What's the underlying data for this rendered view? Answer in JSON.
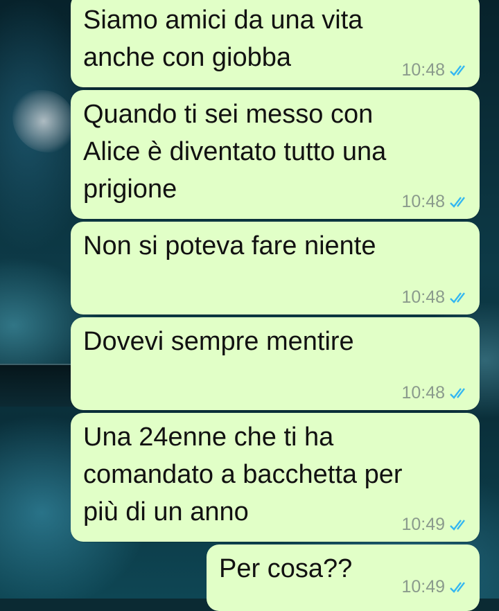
{
  "colors": {
    "bubble": "#e1ffc7",
    "text": "#111111",
    "time": "#8a9a8c",
    "read_ticks": "#34b7f1"
  },
  "messages": [
    {
      "text": "Siamo amici da una vita\nanche con giobba",
      "time": "10:48",
      "status_icon": "double-check-read-icon"
    },
    {
      "text": "Quando ti sei messo con\nAlice è diventato tutto una\nprigione",
      "time": "10:48",
      "status_icon": "double-check-read-icon"
    },
    {
      "text": "Non si poteva fare niente",
      "time": "10:48",
      "status_icon": "double-check-read-icon"
    },
    {
      "text": "Dovevi sempre mentire",
      "time": "10:48",
      "status_icon": "double-check-read-icon"
    },
    {
      "text": "Una 24enne che ti ha\ncomandato a bacchetta per\npiù di un anno",
      "time": "10:49",
      "status_icon": "double-check-read-icon"
    },
    {
      "text": "Per cosa??",
      "time": "10:49",
      "status_icon": "double-check-read-icon"
    }
  ]
}
